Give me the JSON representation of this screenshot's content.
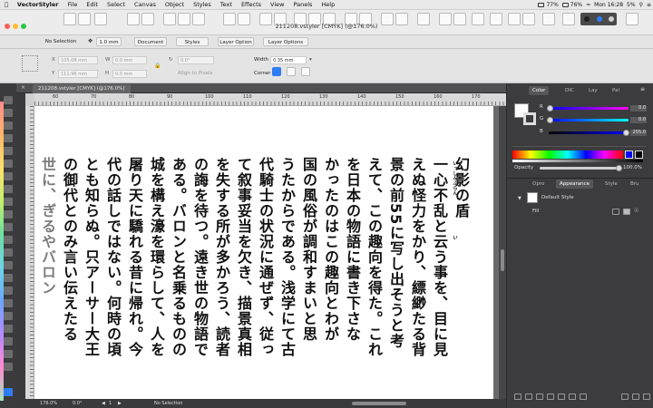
{
  "menubar": {
    "apple": "",
    "app_name": "VectorStyler",
    "items": [
      "File",
      "Edit",
      "Select",
      "Canvas",
      "Object",
      "Styles",
      "Text",
      "Effects",
      "View",
      "Panels",
      "Help"
    ],
    "status": {
      "cpu": "77%",
      "battery": "76%",
      "date": "Mon 16:28",
      "zoom": "5%"
    }
  },
  "window": {
    "title": "211208.vstyler [CMYK] (@176.0%)"
  },
  "context_bar": {
    "selection": "No Selection",
    "stroke_width": "1.0 mm",
    "document_button": "Document",
    "styles_button": "Styles",
    "layer_button": "Layer Option",
    "layer_options_button": "Layer Options"
  },
  "transform": {
    "x_value": "105.08 mm",
    "y_value": "111.96 mm",
    "w_label": "W",
    "h_label": "H",
    "w_value": "0.0 mm",
    "h_value": "0.0 mm",
    "angle_value": "0.0°",
    "align_label": "Align to Pixels",
    "width_label": "Width",
    "width_value": "0.35 mm",
    "corner_label": "Corner"
  },
  "document_tab": {
    "label": "211208.vstyler [CMYK] (@176.0%)"
  },
  "ruler": {
    "ticks": [
      "60",
      "70",
      "80",
      "90",
      "100",
      "110",
      "120",
      "130",
      "140",
      "150",
      "160",
      "170",
      "180"
    ]
  },
  "canvas_text": {
    "columns": [
      "幻影の盾",
      "一心不乱と云う事を、目に見",
      "えぬ怪力をかり、縹緲たる背",
      "景の前55に写し出そうと考",
      "えて、この趣向を得た。これ",
      "を日本の物語に書き下さな",
      "かったのはこの趣向とわが",
      "国の風俗が調和すまいと思",
      "うたからである。浅学にて古",
      "代騎士の状況に通ぜず、従っ",
      "て叙事妥当を欠き、描景真相",
      "を失する所が多かろう、読者",
      "の誨を待つ。遠き世の物語で",
      "ある。バロンと名乗るものの",
      "城を構え濠を環らして、人を",
      "屠り天に驕れる昔に帰れ。今",
      "代の話しではない。何時の頃",
      "とも知らぬ。只アーサー大王",
      "の御代とのみ言い伝えたる",
      "世に、ぎるやバロン"
    ],
    "rubies": [
      "いっしん",
      "ふらん",
      "い"
    ]
  },
  "statusbar": {
    "zoom": "176.0%",
    "angle": "0.0°",
    "page": "1",
    "selection": "No Selection"
  },
  "color_panel": {
    "tabs": [
      "Color",
      "DIC",
      "Lay",
      "Pal"
    ],
    "r_label": "R",
    "g_label": "G",
    "b_label": "B",
    "r_value": "0.0",
    "g_value": "0.0",
    "b_value": "255.0",
    "opacity_label": "Opacity",
    "opacity_value": "100.0%"
  },
  "appearance_panel": {
    "tabs": [
      "Opro",
      "Appearance",
      "Style",
      "Bru"
    ],
    "style_name": "Default Style",
    "fill_label": "Fill"
  },
  "colors": {
    "accent": "#2f7df6",
    "blue": "#0000ff",
    "page": "#ffffff"
  }
}
